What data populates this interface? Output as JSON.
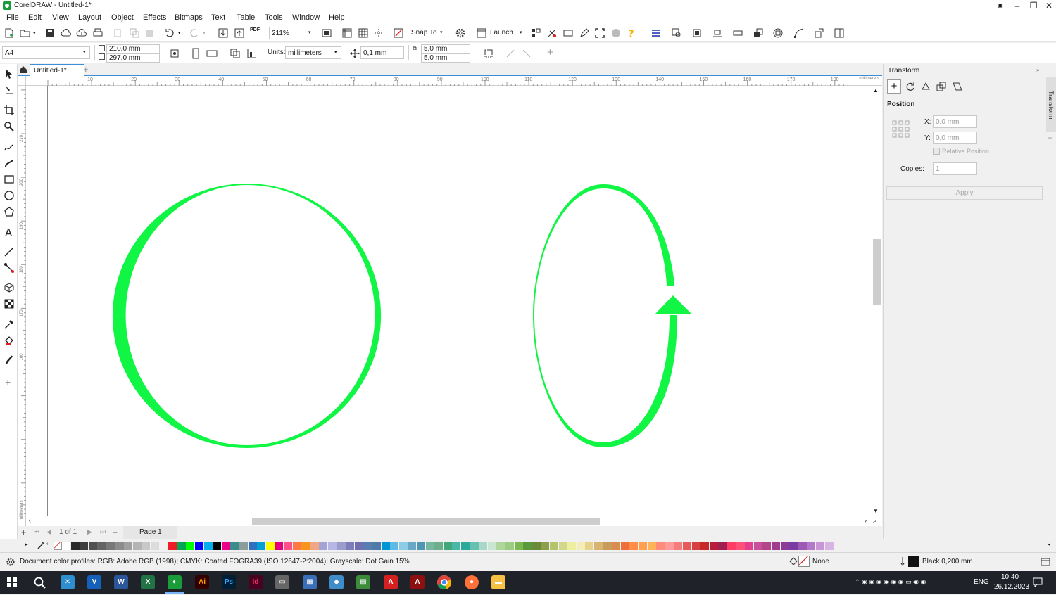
{
  "window": {
    "title": "CorelDRAW - Untitled-1*"
  },
  "menu": [
    "File",
    "Edit",
    "View",
    "Layout",
    "Object",
    "Effects",
    "Bitmaps",
    "Text",
    "Table",
    "Tools",
    "Window",
    "Help"
  ],
  "toolbar": {
    "zoom": "211%",
    "snap_label": "Snap To",
    "launch_label": "Launch"
  },
  "property_bar": {
    "page_size": "A4",
    "width": "210,0 mm",
    "height": "297,0 mm",
    "units_label": "Units:",
    "units": "millimeters",
    "nudge": "0,1 mm",
    "dup_x": "5,0 mm",
    "dup_y": "5,0 mm"
  },
  "document": {
    "tab": "Untitled-1*",
    "ruler_unit": "millimeters",
    "h_ticks": [
      "10",
      "20",
      "30",
      "40",
      "50",
      "60",
      "70",
      "80",
      "90",
      "100",
      "110",
      "120",
      "130",
      "140",
      "150",
      "160",
      "170",
      "180"
    ],
    "v_ticks": [
      "210",
      "200",
      "190",
      "180",
      "170",
      "160"
    ]
  },
  "pagenav": {
    "counter": "1 of 1",
    "page_tab": "Page 1"
  },
  "docker": {
    "title": "Transform",
    "section": "Position",
    "x_label": "X:",
    "x_value": "0,0 mm",
    "y_label": "Y:",
    "y_value": "0,0 mm",
    "relative_label": "Relative Position",
    "copies_label": "Copies:",
    "copies_value": "1",
    "apply_label": "Apply",
    "side_tab": "Transform"
  },
  "status": {
    "profiles": "Document color profiles: RGB: Adobe RGB (1998); CMYK: Coated FOGRA39 (ISO 12647-2:2004); Grayscale: Dot Gain 15%",
    "fill": "None",
    "outline": "Black  0,200 mm"
  },
  "taskbar": {
    "time": "10:40",
    "date": "26.12.2023",
    "lang": "ENG"
  },
  "colors": {
    "shape": "#11f545",
    "accent": "#3b8ed8"
  },
  "palette": [
    "#ffffff",
    "#2b2b2b",
    "#3d3d3d",
    "#505050",
    "#646464",
    "#787878",
    "#8c8c8c",
    "#a0a0a0",
    "#b4b4b4",
    "#c8c8c8",
    "#dcdcdc",
    "#f0f0f0",
    "#ee1c24",
    "#00a651",
    "#00ff00",
    "#0000ff",
    "#00aeef",
    "#000000",
    "#ec008c",
    "#3d8c8c",
    "#8c9c9c",
    "#2e6fbf",
    "#00a0d2",
    "#ffff00",
    "#e6007e",
    "#ff4f8a",
    "#ff7744",
    "#f7941d",
    "#f3a683",
    "#a3a3d6",
    "#b6b6e6",
    "#9c9ccc",
    "#7d7dba",
    "#6e6eb0",
    "#5a7db0",
    "#4d7aa8",
    "#0096d6",
    "#5bbae6",
    "#8ecbe6",
    "#6aa8c8",
    "#4f96b4",
    "#78b7a0",
    "#6caf8a",
    "#3fa87c",
    "#47b8a6",
    "#2aa89c",
    "#66c2b0",
    "#a8d8c8",
    "#c8e6d2",
    "#b0d69c",
    "#9ccc82",
    "#7ab850",
    "#5a9a3c",
    "#6c8c3c",
    "#8ca04c",
    "#b4c46c",
    "#d2d88c",
    "#eef0a0",
    "#f5eeb4",
    "#e6d28c",
    "#d8b470",
    "#c89c5a",
    "#d88c50",
    "#f06e3c",
    "#ff8c46",
    "#ffa050",
    "#ffb45a",
    "#ff8c78",
    "#ff9a9a",
    "#f47c7c",
    "#e85a5a",
    "#d64040",
    "#c82828",
    "#b81c3c",
    "#a01e50",
    "#ff3c64",
    "#ff5078",
    "#e0408c",
    "#c8509c",
    "#b4468c",
    "#a03c8c",
    "#8c3c96",
    "#7a3ca0",
    "#9c5ab4",
    "#b478c8",
    "#c896d6",
    "#d8b4e6"
  ]
}
